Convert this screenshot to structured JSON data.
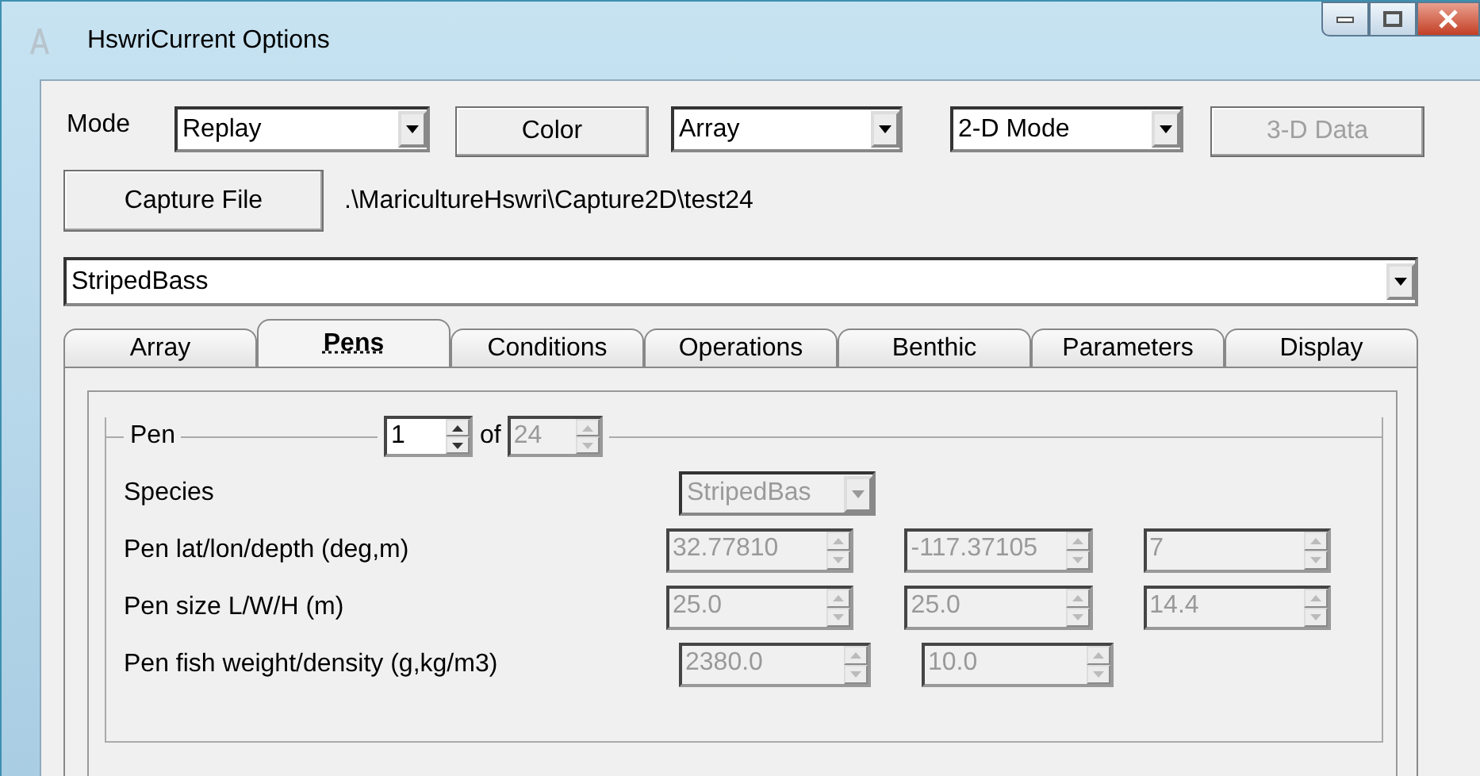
{
  "window": {
    "title": "HswriCurrent Options"
  },
  "toolbar": {
    "mode_label": "Mode",
    "mode": {
      "value": "Replay",
      "disabled": false
    },
    "color_button": {
      "label": "Color",
      "disabled": false
    },
    "view": {
      "value": "Array",
      "disabled": false
    },
    "dimension": {
      "value": "2-D Mode",
      "disabled": false
    },
    "data_button": {
      "label": "3-D Data",
      "disabled": true
    }
  },
  "capture": {
    "button": "Capture File",
    "path": ".\\MaricultureHswri\\Capture2D\\test24"
  },
  "species_combo": {
    "value": "StripedBass"
  },
  "tabs": [
    {
      "label": "Array",
      "selected": false
    },
    {
      "label": "Pens",
      "selected": true
    },
    {
      "label": "Conditions",
      "selected": false
    },
    {
      "label": "Operations",
      "selected": false
    },
    {
      "label": "Benthic",
      "selected": false
    },
    {
      "label": "Parameters",
      "selected": false
    },
    {
      "label": "Display",
      "selected": false
    }
  ],
  "pen_group": {
    "title": "Pen",
    "index": {
      "value": "1",
      "disabled": false
    },
    "of_label": "of",
    "count": {
      "value": "24",
      "disabled": true
    },
    "species": {
      "label": "Species",
      "value": "StripedBas",
      "disabled": true
    },
    "rows": [
      {
        "label": "Pen lat/lon/depth (deg,m)",
        "fields": [
          {
            "value": "32.77810",
            "disabled": true
          },
          {
            "value": "-117.37105",
            "disabled": true
          },
          {
            "value": "7",
            "disabled": true
          }
        ]
      },
      {
        "label": "Pen size L/W/H (m)",
        "fields": [
          {
            "value": "25.0",
            "disabled": true
          },
          {
            "value": "25.0",
            "disabled": true
          },
          {
            "value": "14.4",
            "disabled": true
          }
        ]
      },
      {
        "label": "Pen fish weight/density (g,kg/m3)",
        "fields": [
          {
            "value": "2380.0",
            "disabled": true
          },
          {
            "value": "10.0",
            "disabled": true
          }
        ]
      }
    ]
  }
}
